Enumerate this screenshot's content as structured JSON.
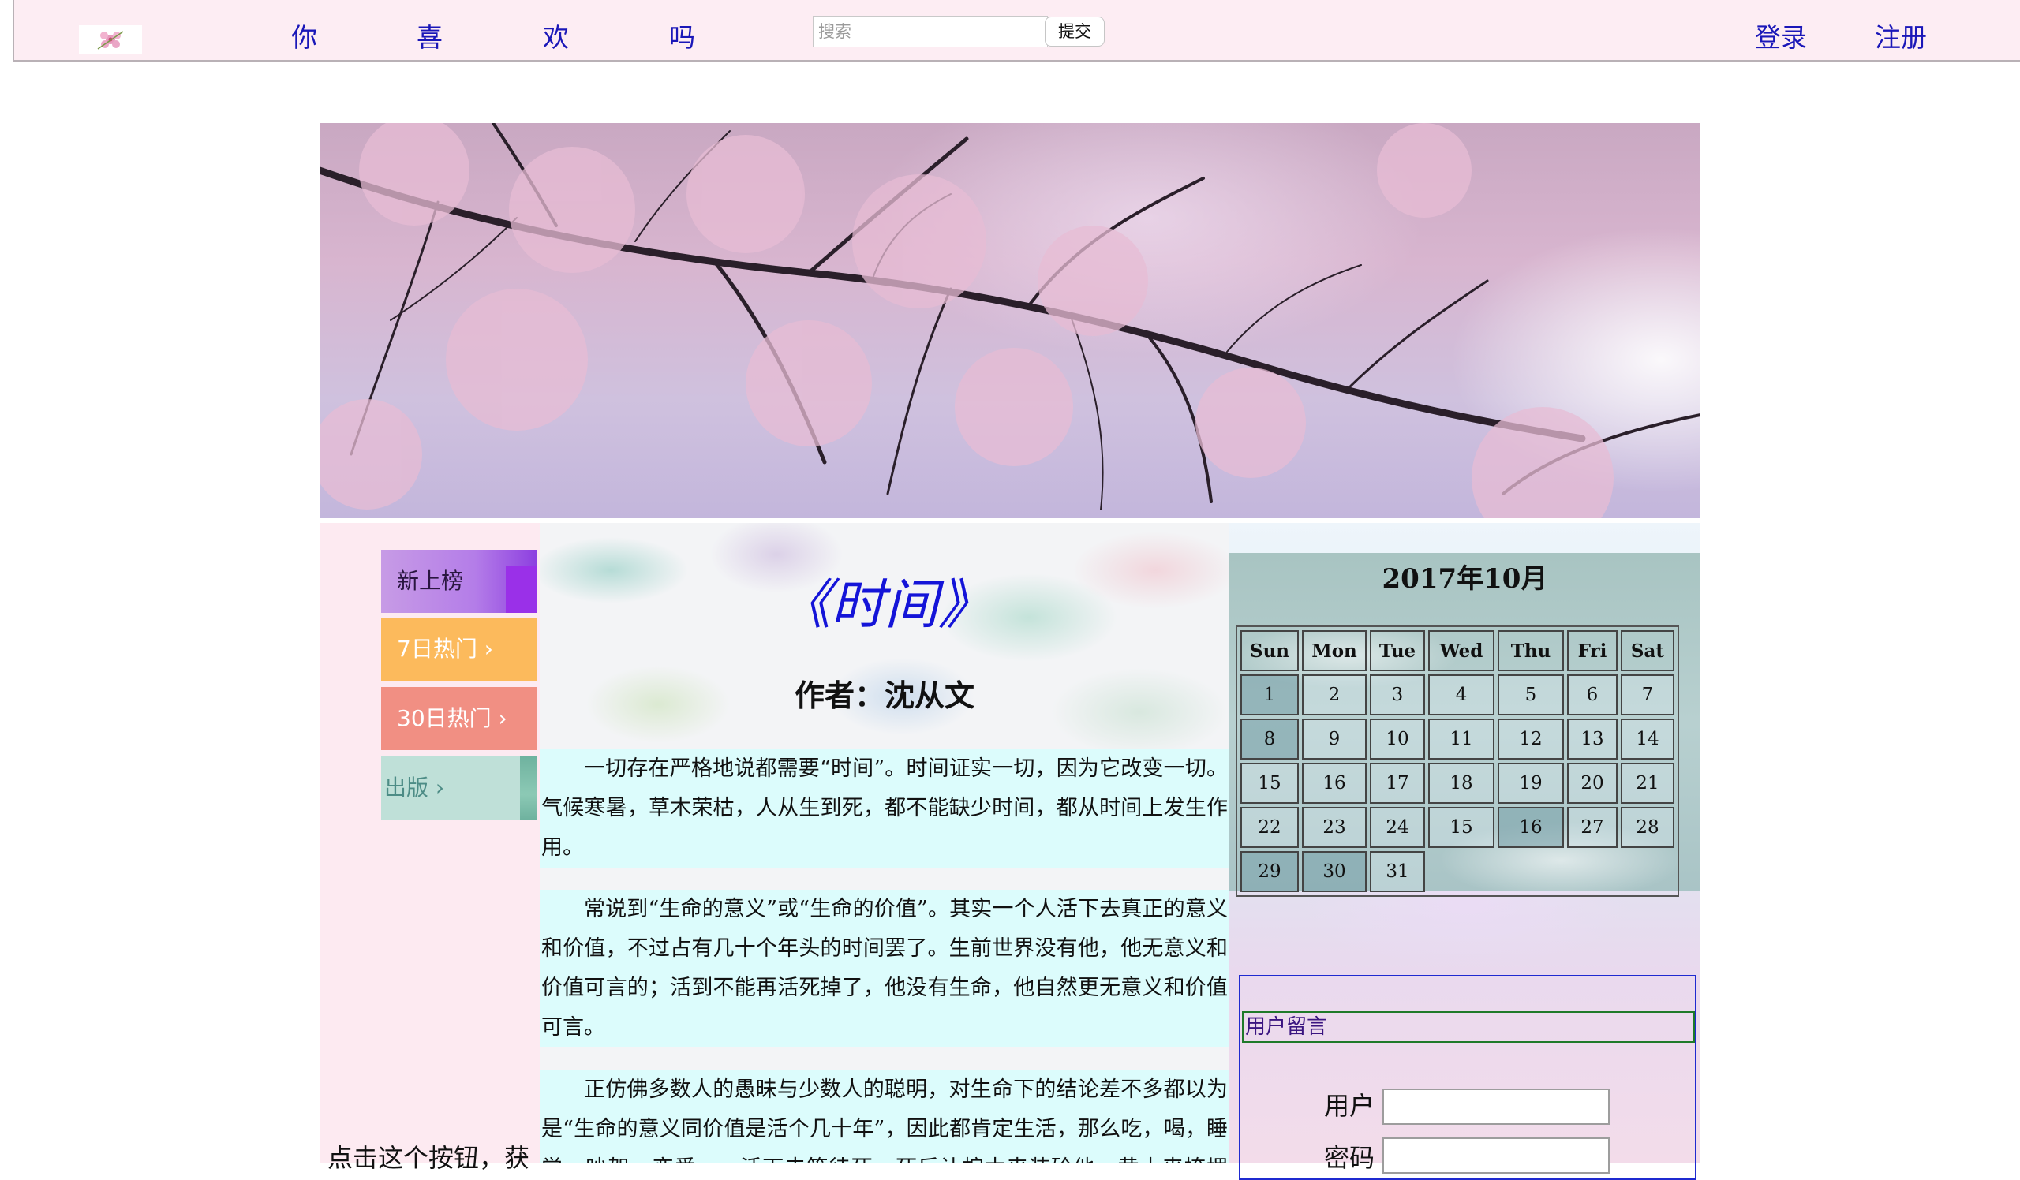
{
  "nav": {
    "links": [
      "你",
      "喜",
      "欢",
      "吗"
    ],
    "search_placeholder": "搜索",
    "submit_label": "提交",
    "login": "登录",
    "register": "注册"
  },
  "menu": {
    "items": [
      "新上榜",
      "7日热门 ›",
      "30日热门 ›",
      "出版 ›"
    ]
  },
  "left_footer": "点击这个按钮，获",
  "article": {
    "title": "《时间》",
    "author": "作者：沈从文",
    "paragraphs": [
      "一切存在严格地说都需要“时间”。时间证实一切，因为它改变一切。气候寒暑，草木荣枯，人从生到死，都不能缺少时间，都从时间上发生作用。",
      "常说到“生命的意义”或“生命的价值”。其实一个人活下去真正的意义和价值，不过占有几十个年头的时间罢了。生前世界没有他，他无意义和价值可言的；活到不能再活死掉了，他没有生命，他自然更无意义和价值可言。",
      "正仿佛多数人的愚昧与少数人的聪明，对生命下的结论差不多都以为是“生命的意义同价值是活个几十年”，因此都肯定生活，那么吃，喝，睡觉，吵架，恋爱……活下去等待死，死后让棺木来装殓他，黄土来掩埋他，"
    ]
  },
  "calendar": {
    "title": "2017年10月",
    "weekdays": [
      "Sun",
      "Mon",
      "Tue",
      "Wed",
      "Thu",
      "Fri",
      "Sat"
    ],
    "weeks": [
      [
        "1",
        "2",
        "3",
        "4",
        "5",
        "6",
        "7"
      ],
      [
        "8",
        "9",
        "10",
        "11",
        "12",
        "13",
        "14"
      ],
      [
        "15",
        "16",
        "17",
        "18",
        "19",
        "20",
        "21"
      ],
      [
        "22",
        "23",
        "24",
        "15",
        "16",
        "27",
        "28"
      ],
      [
        "29",
        "30",
        "31"
      ]
    ]
  },
  "message": {
    "header": "用户留言",
    "user_label": "用户",
    "password_label": "密码"
  },
  "colors": {
    "topbar_bg": "#fdedf3",
    "nav_link": "#1a17b8",
    "article_title": "#1414d8",
    "paragraph_bg": "#dcfcfc",
    "content_bg": "#fdeaf1"
  }
}
